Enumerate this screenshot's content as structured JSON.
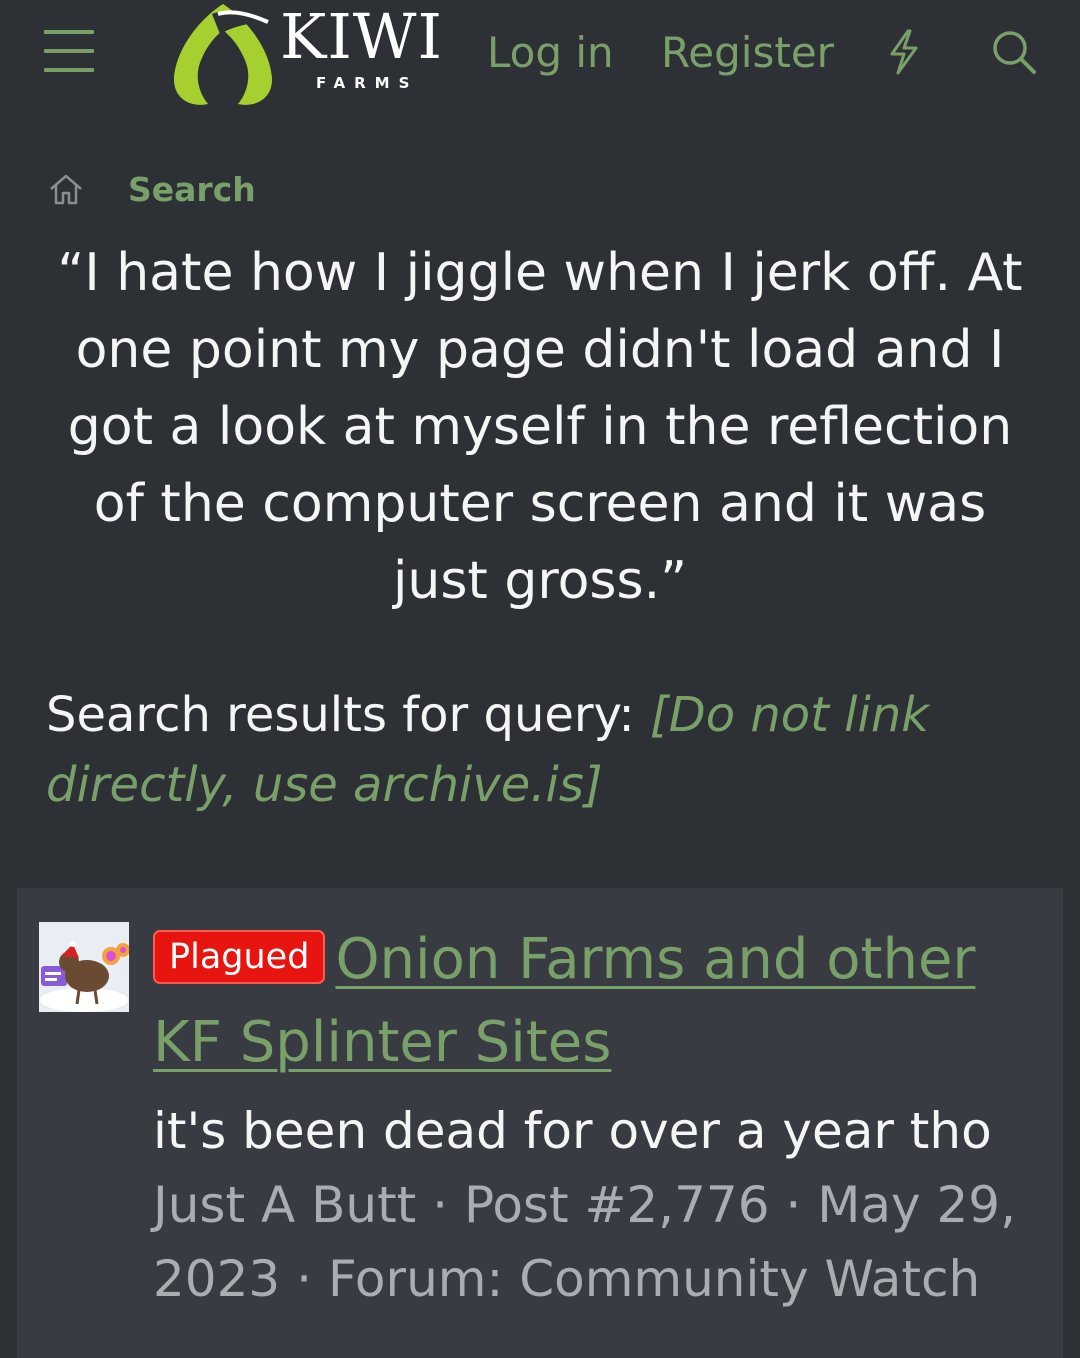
{
  "header": {
    "logo_text": "KIWI",
    "logo_subtext": "FARMS",
    "login_label": "Log in",
    "register_label": "Register",
    "icons": [
      "menu-icon",
      "bolt-icon",
      "search-icon"
    ]
  },
  "breadcrumb": {
    "home_icon": "home-icon",
    "label": "Search"
  },
  "page": {
    "title": "“I hate how I jiggle when I jerk off. At one point my page didn't load and I got a look at myself in the reflection of the computer screen and it was just gross.”",
    "query_prefix": "Search results for query:",
    "query_link": "[Do not link directly, use archive.is]"
  },
  "result": {
    "prefix_badge": "Plagued",
    "title": "Onion Farms and other KF Splinter Sites",
    "snippet": "it's been dead for over a year tho",
    "author": "Just A Butt",
    "sep1": " · ",
    "post_number": "Post #2,776",
    "sep2": " · ",
    "date": "May 29, 2023",
    "sep3": " · ",
    "forum_prefix": "Forum: ",
    "forum": "Community Watch"
  },
  "colors": {
    "background": "#2d3035",
    "card": "#383b41",
    "accent_green": "#7aa06a",
    "badge_red": "#e8140f",
    "meta_gray": "#a9acb0"
  }
}
